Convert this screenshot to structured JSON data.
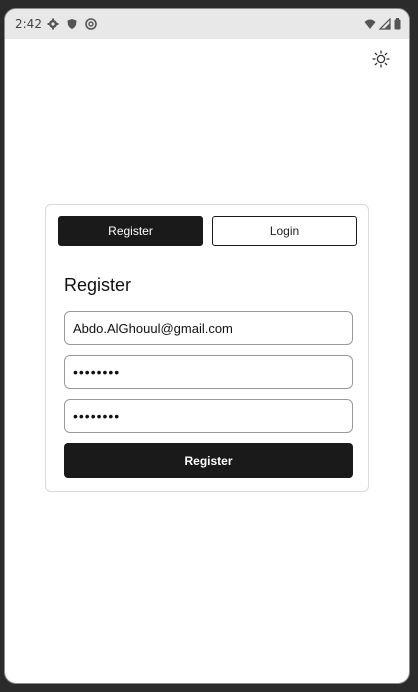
{
  "status_bar": {
    "time": "2:42",
    "left_icons": [
      "gear-icon",
      "shield-icon",
      "sync-icon"
    ],
    "right_icons": [
      "wifi-icon",
      "signal-icon",
      "battery-icon"
    ]
  },
  "header": {
    "theme_icon": "sun-icon"
  },
  "tabs": [
    {
      "label": "Register",
      "active": true
    },
    {
      "label": "Login",
      "active": false
    }
  ],
  "form": {
    "title": "Register",
    "email_value": "Abdo.AlGhouul@gmail.com",
    "password_value": "••••••••",
    "confirm_password_value": "••••••••",
    "submit_label": "Register"
  },
  "colors": {
    "primary": "#1a1a1a",
    "background": "#ffffff",
    "border": "#d9d9d9"
  }
}
